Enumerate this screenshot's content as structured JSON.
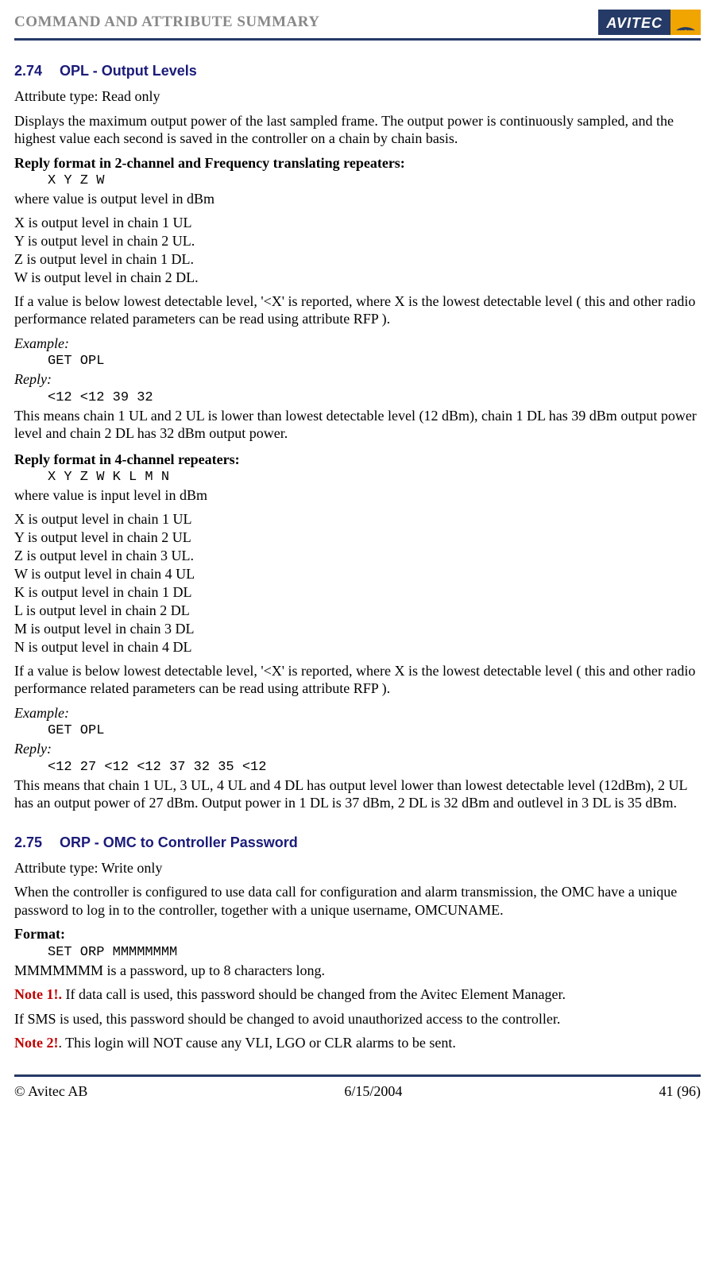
{
  "header": {
    "title": "COMMAND AND ATTRIBUTE SUMMARY",
    "logo_text": "AVITEC"
  },
  "section1": {
    "number": "2.74",
    "title": "OPL - Output Levels",
    "attr_type": "Attribute type: Read only",
    "intro": "Displays the maximum output power of the last sampled frame. The output power is continuously sampled, and the highest value each second is saved in the controller on a chain by chain basis.",
    "reply2ch_label": "Reply format in 2-channel and Frequency translating repeaters:",
    "reply2ch_code": "X Y Z W",
    "reply2ch_where": "where value is output level in dBm",
    "ch2_X": "X is output level in chain 1 UL",
    "ch2_Y": "Y is output level in chain 2 UL.",
    "ch2_Z": "Z is output level in chain 1 DL.",
    "ch2_W": "W is output level in chain 2 DL.",
    "below_detect_2ch": "If a value is below lowest detectable level, '<X' is reported, where X is the lowest detectable level ( this and other radio performance related parameters can be read using attribute RFP ).",
    "example_label": "Example:",
    "example1_code": "GET OPL",
    "reply_label": "Reply:",
    "reply1_code": "<12 <12 39 32",
    "reply1_explain": "This means chain 1 UL and 2 UL is lower than lowest detectable level (12 dBm), chain 1 DL has 39 dBm output power level and chain 2 DL has 32 dBm output power.",
    "reply4ch_label": "Reply format in 4-channel repeaters:",
    "reply4ch_code": "X Y Z W K L M N",
    "reply4ch_where": "where value is input level in dBm",
    "ch4_X": "X is output level in chain 1 UL",
    "ch4_Y": "Y is output level in chain 2 UL",
    "ch4_Z": "Z is output level in chain 3 UL.",
    "ch4_W": "W is output level in chain 4 UL",
    "ch4_K": "K is output level in chain 1 DL",
    "ch4_L": "L is output level in chain 2 DL",
    "ch4_M": "M is output level in chain 3 DL",
    "ch4_N": "N is output level in chain 4 DL",
    "below_detect_4ch": "If a value is below lowest detectable level, '<X' is reported, where X is the lowest detectable level ( this and other radio performance related parameters can be read using attribute RFP ).",
    "example2_code": "GET OPL",
    "reply2_code": "<12 27 <12 <12 37 32 35 <12",
    "reply2_explain": "This means that chain 1 UL, 3 UL, 4 UL and 4 DL has output level lower than lowest detectable level (12dBm), 2 UL has an output power of 27 dBm. Output power in 1 DL is 37 dBm, 2 DL is 32 dBm and outlevel in 3 DL is 35 dBm."
  },
  "section2": {
    "number": "2.75",
    "title": "ORP  - OMC to Controller Password",
    "attr_type": "Attribute type: Write only",
    "intro": "When the controller is configured to use data call for configuration and alarm transmission, the OMC have a unique password to log in to the controller, together with a unique username, OMCUNAME.",
    "format_label": "Format:",
    "format_code": "SET ORP MMMMMMMM",
    "format_explain": "MMMMMMM is a password, up to 8 characters long.",
    "note1_label": "Note 1!.",
    "note1_text": " If data call is used, this password should be changed from the Avitec Element Manager.",
    "sms_text": "If SMS is used, this password should be changed to avoid unauthorized access to the controller.",
    "note2_label": "Note 2!",
    "note2_text": ". This login will NOT cause any VLI, LGO or CLR alarms to be sent."
  },
  "footer": {
    "left": "© Avitec AB",
    "center": "6/15/2004",
    "right": "41 (96)"
  }
}
